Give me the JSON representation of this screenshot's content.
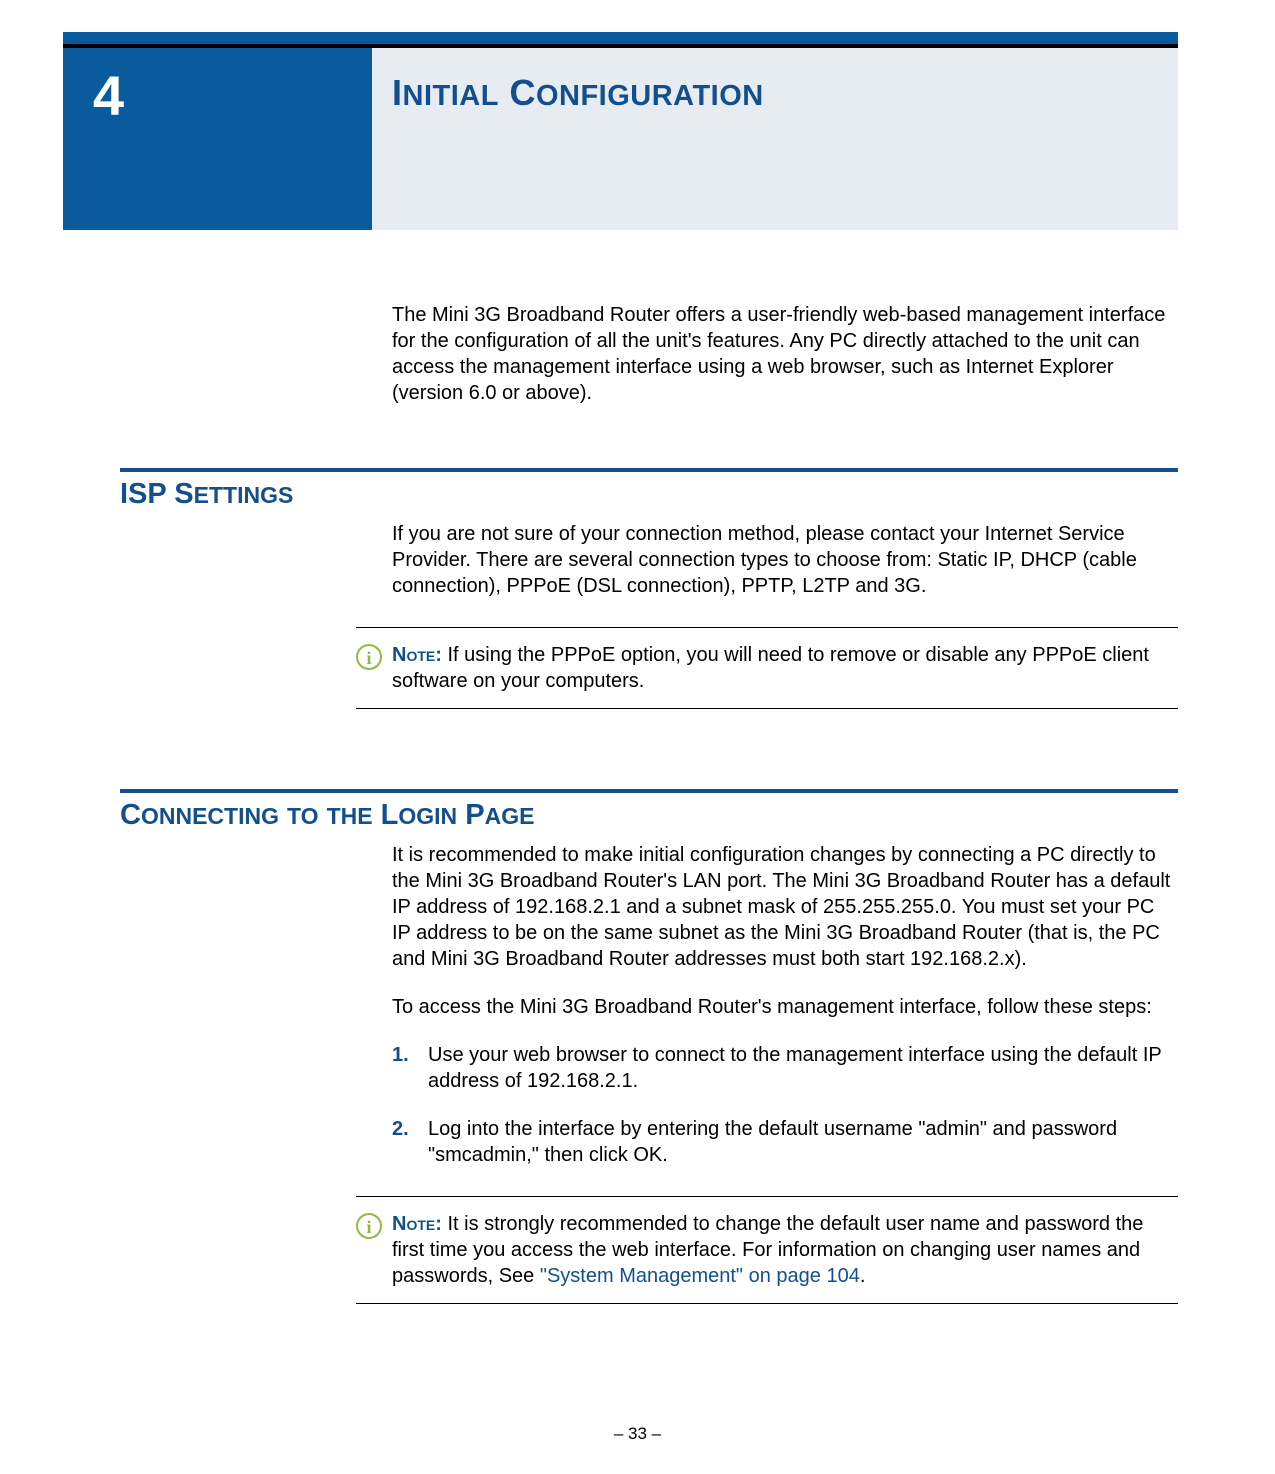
{
  "chapter": {
    "number": "4",
    "title_caps1": "I",
    "title_small1": "NITIAL",
    "title_caps2": " C",
    "title_small2": "ONFIGURATION"
  },
  "intro": "The Mini 3G Broadband Router offers a user-friendly web-based management interface for the configuration of all the unit's features. Any PC directly attached to the unit can access the management interface using a web browser, such as Internet Explorer (version 6.0 or above).",
  "section1": {
    "heading_big": "ISP S",
    "heading_small": "ETTINGS",
    "body": "If you are not sure of your connection method, please contact your Internet Service Provider. There are several connection types to choose from: Static IP, DHCP (cable connection), PPPoE (DSL connection), PPTP, L2TP and 3G.",
    "note_label": "Note: ",
    "note_text": "If using the PPPoE option, you will need to remove or disable any PPPoE client software on your computers."
  },
  "section2": {
    "heading_big1": "C",
    "heading_small1": "ONNECTING",
    "heading_big2": " ",
    "heading_small2": "TO",
    "heading_big3": " ",
    "heading_small3": "THE",
    "heading_big4": " L",
    "heading_small4": "OGIN",
    "heading_big5": " P",
    "heading_small5": "AGE",
    "body1": "It is recommended to make initial configuration changes by connecting a PC directly to the Mini 3G Broadband Router's LAN port. The Mini 3G Broadband Router has a default IP address of 192.168.2.1 and a subnet mask of 255.255.255.0. You must set your PC IP address to be on the same subnet as the Mini 3G Broadband Router (that is, the PC and Mini 3G Broadband Router addresses must both start 192.168.2.x).",
    "body2": "To access the Mini 3G Broadband Router's management interface, follow these steps:",
    "steps": [
      {
        "num": "1.",
        "text": "Use your web browser to connect to the management interface using the default IP address of 192.168.2.1."
      },
      {
        "num": "2.",
        "text": "Log into the interface by entering the default username \"admin\" and password \"smcadmin,\" then click OK."
      }
    ],
    "note_label": "Note: ",
    "note_text_part1": "It is strongly recommended to change the default user name and password the first time you access the web interface. For information on changing user names and passwords, See ",
    "note_link": "\"System Management\" on page 104",
    "note_text_part2": "."
  },
  "footer": "–  33  –"
}
